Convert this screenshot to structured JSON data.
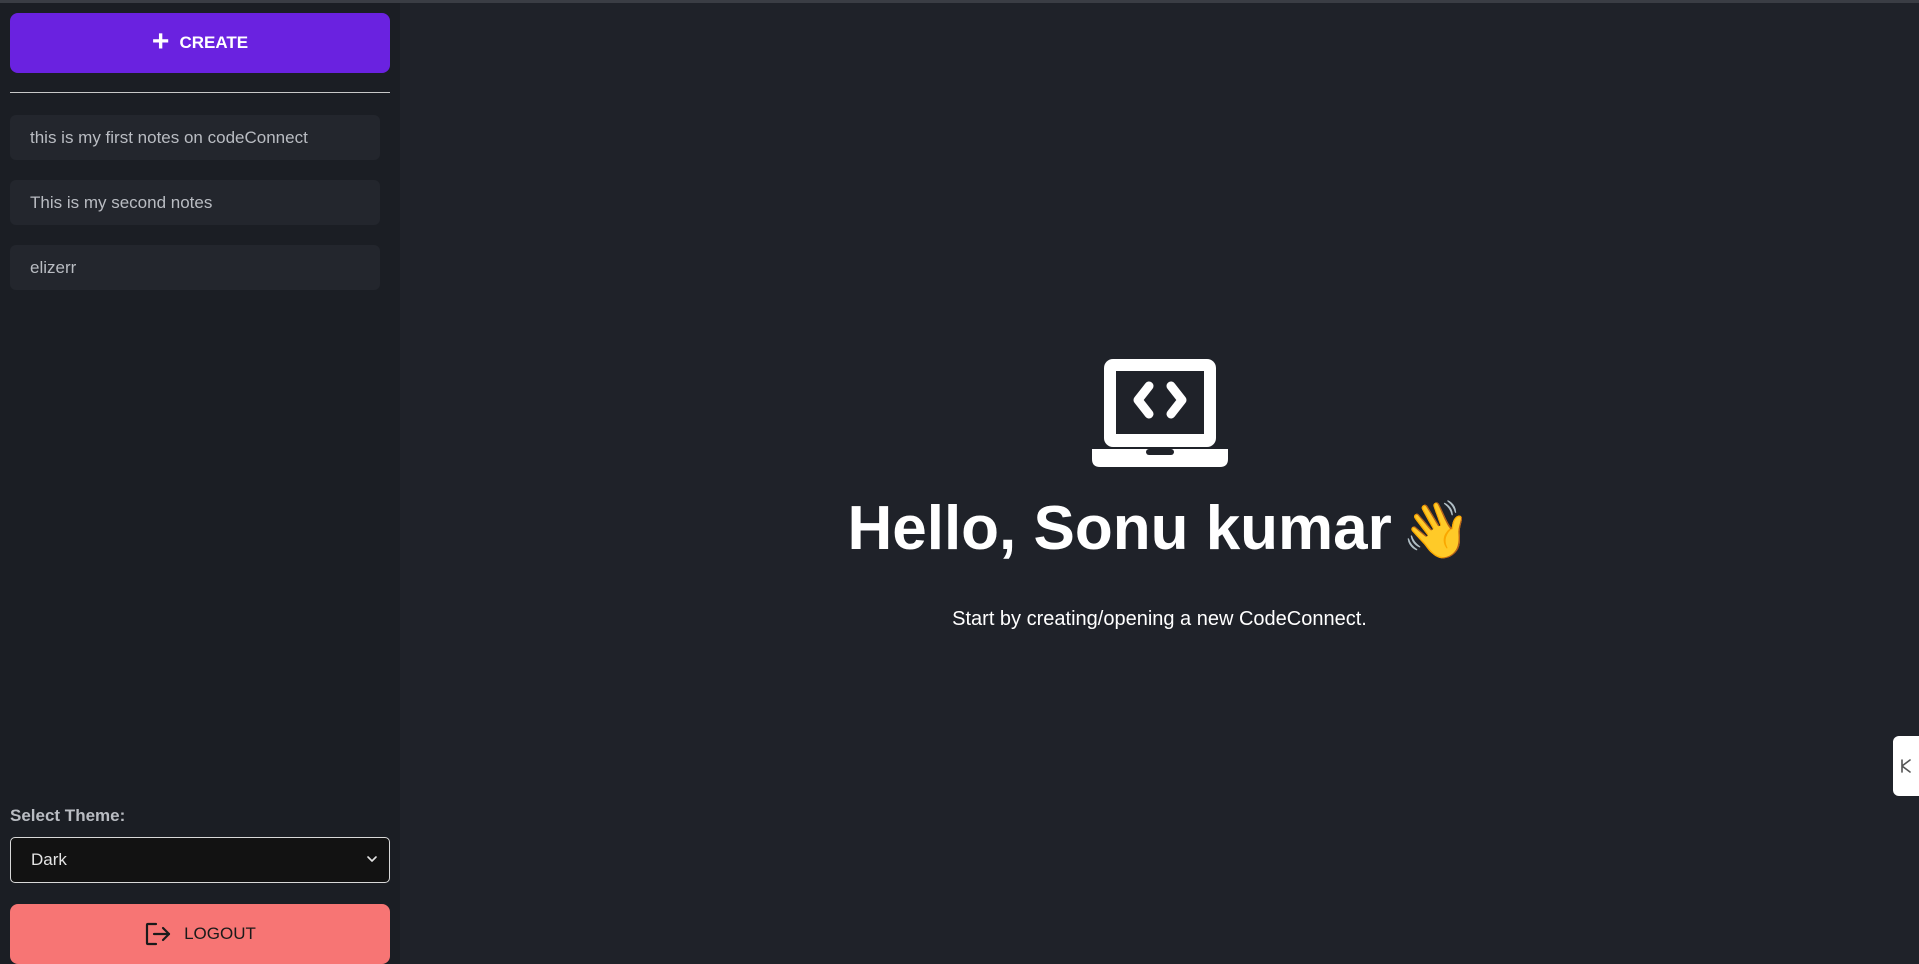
{
  "sidebar": {
    "create_label": "CREATE",
    "create_icon": "plus-icon",
    "notes": [
      {
        "title": "this is my first notes on codeConnect"
      },
      {
        "title": "This is my second notes"
      },
      {
        "title": "elizerr"
      }
    ],
    "theme_label": "Select Theme:",
    "theme_value": "Dark",
    "logout_label": "LOGOUT",
    "logout_icon": "logout-icon"
  },
  "main": {
    "icon": "laptop-code-icon",
    "greeting": "Hello, Sonu kumar",
    "greeting_emoji": "👋",
    "subtitle": "Start by creating/opening a new CodeConnect."
  },
  "colors": {
    "background": "#1f2229",
    "sidebar_bg": "#1b1e24",
    "create_button": "#6a22e0",
    "logout_button": "#f77574",
    "note_item_bg": "#23262d"
  }
}
